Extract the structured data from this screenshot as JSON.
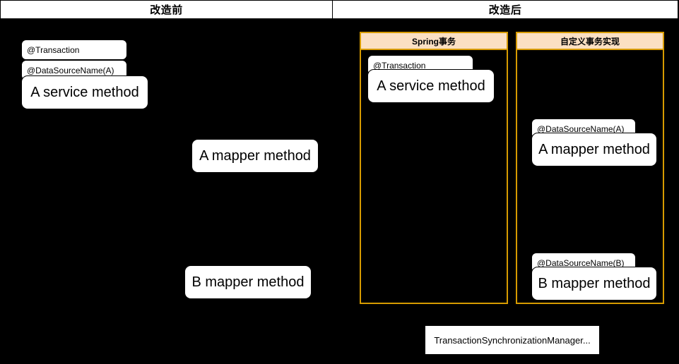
{
  "colors": {
    "background": "#000000",
    "node_fill": "#ffffff",
    "node_stroke": "#000000",
    "lane_stroke": "#d79b00",
    "lane_header_fill": "#fbe0c3"
  },
  "headers": {
    "left": "改造前",
    "right": "改造后"
  },
  "before": {
    "annotation_transaction": "@Transaction",
    "annotation_datasource_a": "@DataSourceName(A)",
    "service_method": "A service method",
    "mapper_a": "A mapper method",
    "mapper_b": "B mapper method"
  },
  "after": {
    "spring_lane": {
      "title": "Spring事务",
      "annotation_transaction": "@Transaction",
      "service_method": "A service method"
    },
    "custom_lane": {
      "title": "自定义事务实现",
      "annotation_datasource_a": "@DataSourceName(A)",
      "mapper_a": "A mapper method",
      "annotation_datasource_b": "@DataSourceName(B)",
      "mapper_b": "B mapper method"
    },
    "footer_note": "TransactionSynchronizationManager..."
  }
}
